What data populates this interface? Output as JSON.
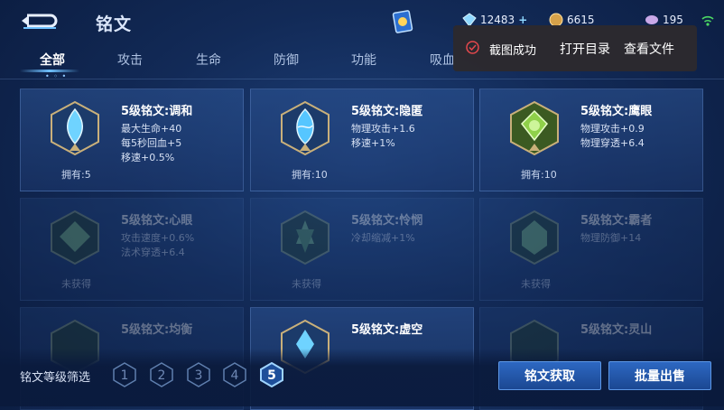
{
  "header": {
    "title": "铭文",
    "currencies": [
      {
        "name": "diamond-icon",
        "value": "12483"
      },
      {
        "name": "gold-coin-icon",
        "value": "6615"
      },
      {
        "name": "crystal-icon",
        "value": "195"
      }
    ]
  },
  "tabs": [
    "全部",
    "攻击",
    "生命",
    "防御",
    "功能",
    "吸血"
  ],
  "tab_dots": "• ◦ •",
  "cards": [
    {
      "name": "5级铭文:调和",
      "stats": [
        "最大生命+40",
        "每5秒回血+5",
        "移速+0.5%"
      ],
      "owned": "拥有:5",
      "color": "#6fd3ff",
      "state": "owned"
    },
    {
      "name": "5级铭文:隐匿",
      "stats": [
        "物理攻击+1.6",
        "移速+1%"
      ],
      "owned": "拥有:10",
      "color": "#56c6ff",
      "state": "owned"
    },
    {
      "name": "5级铭文:鹰眼",
      "stats": [
        "物理攻击+0.9",
        "物理穿透+6.4"
      ],
      "owned": "拥有:10",
      "color": "#8fd04a",
      "state": "owned"
    },
    {
      "name": "5级铭文:心眼",
      "stats": [
        "攻击速度+0.6%",
        "法术穿透+6.4"
      ],
      "owned": "未获得",
      "color": "#7fc07a",
      "state": "locked"
    },
    {
      "name": "5级铭文:怜悯",
      "stats": [
        "冷却缩减+1%"
      ],
      "owned": "未获得",
      "color": "#7fc07a",
      "state": "locked"
    },
    {
      "name": "5级铭文:霸者",
      "stats": [
        "物理防御+14"
      ],
      "owned": "未获得",
      "color": "#7fc07a",
      "state": "locked"
    },
    {
      "name": "5级铭文:均衡",
      "stats": [],
      "owned": "",
      "color": "#7fc07a",
      "state": "locked"
    },
    {
      "name": "5级铭文:虚空",
      "stats": [],
      "owned": "",
      "color": "#6fd3ff",
      "state": "owned"
    },
    {
      "name": "5级铭文:灵山",
      "stats": [],
      "owned": "",
      "color": "#7fc07a",
      "state": "locked"
    }
  ],
  "popup": {
    "message": "截图成功",
    "open_dir": "打开目录",
    "view_file": "查看文件"
  },
  "filter": {
    "label": "铭文等级筛选",
    "levels": [
      "1",
      "2",
      "3",
      "4",
      "5"
    ],
    "selected": "5"
  },
  "buttons": {
    "acquire": "铭文获取",
    "bulk_sell": "批量出售"
  },
  "colors": {
    "accent": "#6fc1ff",
    "button": "#2d68c2",
    "popup_bg": "#2d2a2e",
    "check": "#e5484d"
  }
}
